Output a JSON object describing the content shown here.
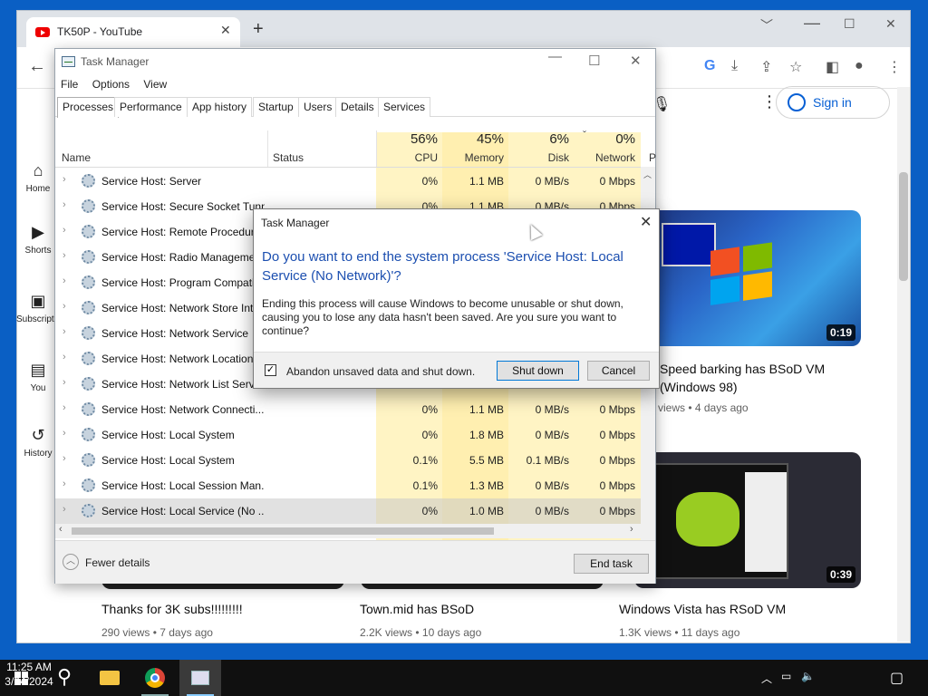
{
  "browser": {
    "tab_title": "TK50P - YouTube",
    "tab_close": "✕",
    "new_tab": "+",
    "minimize": "﹀",
    "restore": "☐",
    "close": "✕"
  },
  "youtube": {
    "sign_in": "Sign in",
    "sidebar": [
      "Home",
      "Shorts",
      "Subscriptions",
      "You",
      "History"
    ],
    "videos": [
      {
        "title": "Speed barking has BSoD VM",
        "title2": "(Windows 98)",
        "meta": "views • 4 days ago",
        "duration": "0:19"
      },
      {
        "title": "Windows Vista has RSoD VM",
        "meta": "1.3K views • 11 days ago",
        "duration": "0:39"
      },
      {
        "title": "Thanks for 3K subs!!!!!!!!!",
        "meta": "290 views • 7 days ago"
      },
      {
        "title": "Town.mid has BSoD",
        "meta": "2.2K views • 10 days ago"
      }
    ]
  },
  "task_manager": {
    "title": "Task Manager",
    "menu": [
      "File",
      "Options",
      "View"
    ],
    "tabs": [
      "Processes",
      "Performance",
      "App history",
      "Startup",
      "Users",
      "Details",
      "Services"
    ],
    "columns": {
      "name": "Name",
      "status": "Status",
      "cpu_pct": "56%",
      "cpu": "CPU",
      "mem_pct": "45%",
      "mem": "Memory",
      "disk_pct": "6%",
      "disk": "Disk",
      "net_pct": "0%",
      "net": "Network",
      "power": "P"
    },
    "rows": [
      {
        "name": "Service Host: Server",
        "cpu": "0%",
        "mem": "1.1 MB",
        "disk": "0 MB/s",
        "net": "0 Mbps"
      },
      {
        "name": "Service Host: Secure Socket Tunneling",
        "cpu": "0%",
        "mem": "1.1 MB",
        "disk": "0 MB/s",
        "net": "0 Mbps"
      },
      {
        "name": "Service Host: Remote Procedure Call",
        "cpu": "",
        "mem": "",
        "disk": "",
        "net": ""
      },
      {
        "name": "Service Host: Radio Manageme...",
        "cpu": "",
        "mem": "",
        "disk": "",
        "net": ""
      },
      {
        "name": "Service Host: Program Compatibility",
        "cpu": "",
        "mem": "",
        "disk": "",
        "net": ""
      },
      {
        "name": "Service Host: Network Store Interface",
        "cpu": "",
        "mem": "",
        "disk": "",
        "net": ""
      },
      {
        "name": "Service Host: Network Service",
        "cpu": "",
        "mem": "",
        "disk": "",
        "net": ""
      },
      {
        "name": "Service Host: Network Location Awareness",
        "cpu": "",
        "mem": "",
        "disk": "",
        "net": ""
      },
      {
        "name": "Service Host: Network List Service",
        "cpu": "",
        "mem": "",
        "disk": "",
        "net": ""
      },
      {
        "name": "Service Host: Network Connecti...",
        "cpu": "0%",
        "mem": "1.1 MB",
        "disk": "0 MB/s",
        "net": "0 Mbps"
      },
      {
        "name": "Service Host: Local System",
        "cpu": "0%",
        "mem": "1.8 MB",
        "disk": "0 MB/s",
        "net": "0 Mbps"
      },
      {
        "name": "Service Host: Local System",
        "cpu": "0.1%",
        "mem": "5.5 MB",
        "disk": "0.1 MB/s",
        "net": "0 Mbps"
      },
      {
        "name": "Service Host: Local Session Man...",
        "cpu": "0.1%",
        "mem": "1.3 MB",
        "disk": "0 MB/s",
        "net": "0 Mbps"
      },
      {
        "name": "Service Host: Local Service (No ...",
        "cpu": "0%",
        "mem": "1.0 MB",
        "disk": "0 MB/s",
        "net": "0 Mbps"
      }
    ],
    "fewer_details": "Fewer details",
    "end_task": "End task"
  },
  "dialog": {
    "title": "Task Manager",
    "question": "Do you want to end the system process 'Service Host: Local Service (No Network)'?",
    "body": "Ending this process will cause Windows to become unusable or shut down, causing you to lose any data hasn't been saved. Are you sure you want to continue?",
    "checkbox_label": "Abandon unsaved data and shut down.",
    "checkbox_mark": "✓",
    "shutdown": "Shut down",
    "cancel": "Cancel",
    "close": "✕"
  },
  "taskbar": {
    "time": "11:25 AM",
    "date": "3/24/2024"
  }
}
